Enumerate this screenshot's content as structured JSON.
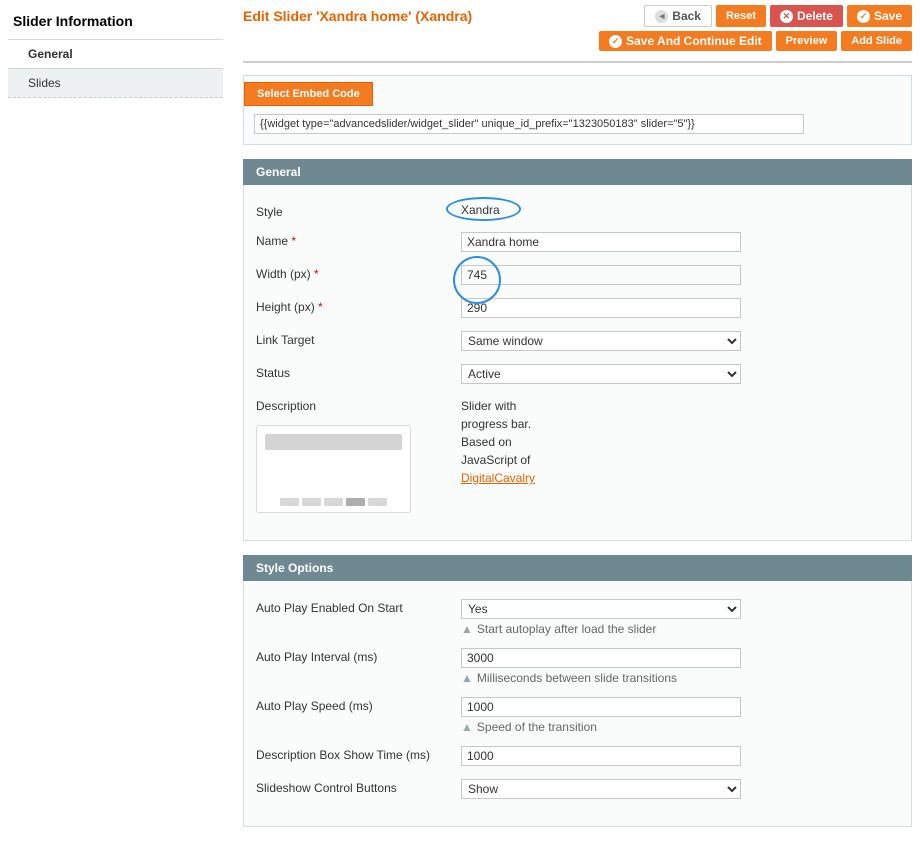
{
  "sidebar": {
    "title": "Slider Information",
    "tabs": [
      {
        "label": "General",
        "active": true
      },
      {
        "label": "Slides",
        "active": false
      }
    ]
  },
  "header": {
    "title": "Edit Slider 'Xandra home' (Xandra)",
    "buttons": {
      "back": "Back",
      "reset": "Reset",
      "delete": "Delete",
      "save": "Save",
      "save_continue": "Save And Continue Edit",
      "preview": "Preview",
      "add_slide": "Add Slide"
    }
  },
  "embed": {
    "tab": "Select Embed Code",
    "value": "{{widget type=\"advancedslider/widget_slider\" unique_id_prefix=\"1323050183\" slider=\"5\"}}"
  },
  "general": {
    "head": "General",
    "labels": {
      "style": "Style",
      "name": "Name",
      "width": "Width (px)",
      "height": "Height (px)",
      "link_target": "Link Target",
      "status": "Status",
      "description": "Description"
    },
    "values": {
      "style": "Xandra",
      "name": "Xandra home",
      "width": "745",
      "height": "290",
      "link_target": "Same window",
      "status": "Active"
    },
    "desc_lines": [
      "Slider with",
      "progress bar.",
      "Based on",
      "JavaScript of"
    ],
    "desc_link": "DigitalCavalry"
  },
  "style_options": {
    "head": "Style Options",
    "labels": {
      "autoplay": "Auto Play Enabled On Start",
      "interval": "Auto Play Interval (ms)",
      "speed": "Auto Play Speed (ms)",
      "desc_show": "Description Box Show Time (ms)",
      "control_buttons": "Slideshow Control Buttons"
    },
    "values": {
      "autoplay": "Yes",
      "interval": "3000",
      "speed": "1000",
      "desc_show": "1000",
      "control_buttons": "Show"
    },
    "hints": {
      "autoplay": "Start autoplay after load the slider",
      "interval": "Milliseconds between slide transitions",
      "speed": "Speed of the transition"
    }
  }
}
